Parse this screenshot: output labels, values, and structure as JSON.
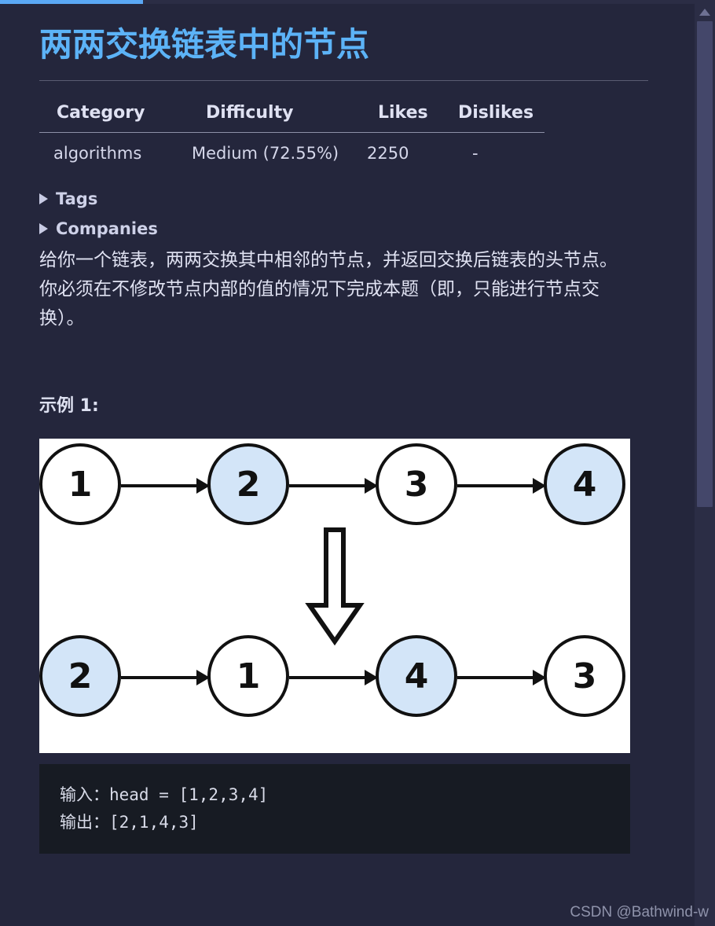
{
  "browser": {
    "progress_percent": 20
  },
  "scrollbar": {
    "up_arrow_icon": "caret-up-icon"
  },
  "problem": {
    "title": "两两交换链表中的节点",
    "meta_table": {
      "headers": [
        "Category",
        "Difficulty",
        "Likes",
        "Dislikes"
      ],
      "rows": [
        [
          "algorithms",
          "Medium (72.55%)",
          "2250",
          "-"
        ]
      ]
    },
    "disclosures": [
      {
        "label": "Tags",
        "expanded": false,
        "icon": "triangle-right-icon"
      },
      {
        "label": "Companies",
        "expanded": false,
        "icon": "triangle-right-icon"
      }
    ],
    "description": "给你一个链表，两两交换其中相邻的节点，并返回交换后链表的头节点。你必须在不修改节点内部的值的情况下完成本题（即，只能进行节点交换）。",
    "example_heading": "示例 1:",
    "figure": {
      "alt": "linked-list-swap-diagram",
      "background": "#ffffff",
      "node_fill_white": "#ffffff",
      "node_fill_blue": "#d3e5f8",
      "node_stroke": "#111111",
      "transition_icon": "down-arrow-icon",
      "top_row": [
        {
          "value": "1",
          "fill": "white"
        },
        {
          "value": "2",
          "fill": "blue"
        },
        {
          "value": "3",
          "fill": "white"
        },
        {
          "value": "4",
          "fill": "blue"
        }
      ],
      "bottom_row": [
        {
          "value": "2",
          "fill": "blue"
        },
        {
          "value": "1",
          "fill": "white"
        },
        {
          "value": "4",
          "fill": "blue"
        },
        {
          "value": "3",
          "fill": "white"
        }
      ]
    },
    "code_block": {
      "lines": [
        "输入：head = [1,2,3,4]",
        "输出：[2,1,4,3]"
      ]
    }
  },
  "watermark": "CSDN @Bathwind-w",
  "colors": {
    "page_background": "#24263c",
    "title_accent": "#5cb3f7",
    "progress_accent": "#5aa8f5",
    "code_background": "#171b23",
    "scrollbar_thumb": "#44476a"
  }
}
